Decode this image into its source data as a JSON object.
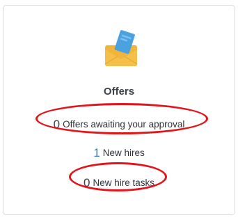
{
  "card": {
    "icon": "envelope-with-letter-icon",
    "title": "Offers",
    "stats": [
      {
        "count": "0",
        "label": "Offers awaiting your approval",
        "count_color": "#3b4148",
        "highlighted": true
      },
      {
        "count": "1",
        "label": "New hires",
        "count_color": "#2f7cc4",
        "highlighted": false
      },
      {
        "count": "0",
        "label": "New hire tasks",
        "count_color": "#3b4148",
        "highlighted": true
      }
    ]
  },
  "colors": {
    "envelope": "#f5c04a",
    "envelope_flap": "#f8d27a",
    "letter": "#4aa3df",
    "annotation_ring": "#e3141b"
  }
}
